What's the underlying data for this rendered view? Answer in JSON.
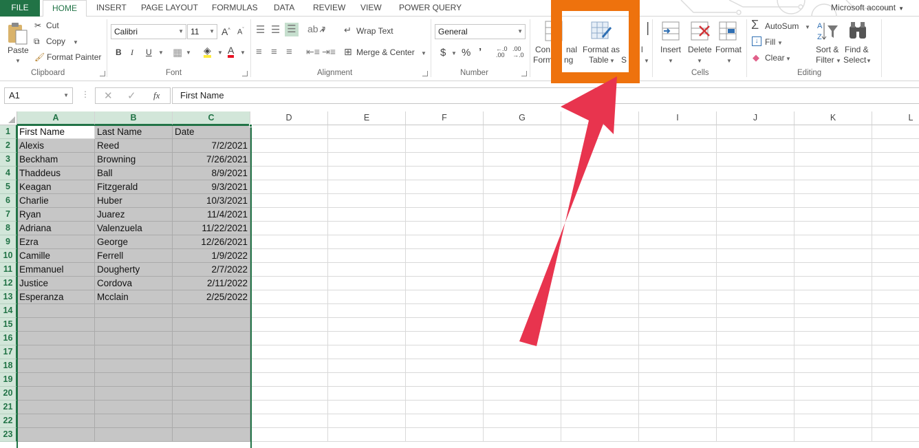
{
  "tabs": [
    "FILE",
    "HOME",
    "INSERT",
    "PAGE LAYOUT",
    "FORMULAS",
    "DATA",
    "REVIEW",
    "VIEW",
    "POWER QUERY"
  ],
  "account": "Microsoft account",
  "clipboard": {
    "paste": "Paste",
    "cut": "Cut",
    "copy": "Copy",
    "format_painter": "Format Painter",
    "label": "Clipboard"
  },
  "font": {
    "name": "Calibri",
    "size": "11",
    "bold": "B",
    "italic": "I",
    "underline": "U",
    "label": "Font"
  },
  "alignment": {
    "wrap_text": "Wrap Text",
    "merge_center": "Merge & Center",
    "label": "Alignment"
  },
  "number": {
    "format": "General",
    "currency": "$",
    "percent": "%",
    "comma": "’",
    "label": "Number"
  },
  "styles": {
    "conditional_1": "Con",
    "conditional_2": "nal",
    "conditional_3": "Form",
    "conditional_4": "ng",
    "format_as_table_1": "Format as",
    "format_as_table_2": "Table",
    "cell_styles_1": "l",
    "cell_styles_2": "S"
  },
  "cells_group": {
    "insert": "Insert",
    "delete": "Delete",
    "format": "Format",
    "label": "Cells"
  },
  "editing": {
    "autosum": "AutoSum",
    "fill": "Fill",
    "clear": "Clear",
    "sort_1": "Sort &",
    "sort_2": "Filter",
    "find_1": "Find &",
    "find_2": "Select",
    "label": "Editing"
  },
  "formula_bar": {
    "name_box": "A1",
    "fx": "fx",
    "content": "First Name"
  },
  "columns": [
    "A",
    "B",
    "C",
    "D",
    "E",
    "F",
    "G",
    "H",
    "I",
    "J",
    "K",
    "L"
  ],
  "row_numbers": [
    "1",
    "2",
    "3",
    "4",
    "5",
    "6",
    "7",
    "8",
    "9",
    "10",
    "11",
    "12",
    "13",
    "14",
    "15",
    "16",
    "17",
    "18",
    "19",
    "20",
    "21",
    "22",
    "23"
  ],
  "rows": [
    [
      "First Name",
      "Last Name",
      "Date"
    ],
    [
      "Alexis",
      "Reed",
      "7/2/2021"
    ],
    [
      "Beckham",
      "Browning",
      "7/26/2021"
    ],
    [
      "Thaddeus",
      "Ball",
      "8/9/2021"
    ],
    [
      "Keagan",
      "Fitzgerald",
      "9/3/2021"
    ],
    [
      "Charlie",
      "Huber",
      "10/3/2021"
    ],
    [
      "Ryan",
      "Juarez",
      "11/4/2021"
    ],
    [
      "Adriana",
      "Valenzuela",
      "11/22/2021"
    ],
    [
      "Ezra",
      "George",
      "12/26/2021"
    ],
    [
      "Camille",
      "Ferrell",
      "1/9/2022"
    ],
    [
      "Emmanuel",
      "Dougherty",
      "2/7/2022"
    ],
    [
      "Justice",
      "Cordova",
      "2/11/2022"
    ],
    [
      "Esperanza",
      "Mcclain",
      "2/25/2022"
    ]
  ],
  "colors": {
    "accent": "#217346",
    "highlight": "#ee720d",
    "arrow": "#e8344e",
    "selection": "#c6c6c6"
  }
}
